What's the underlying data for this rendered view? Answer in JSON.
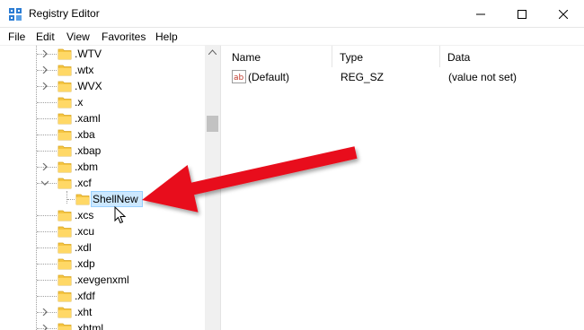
{
  "window": {
    "title": "Registry Editor",
    "icon": "registry-icon"
  },
  "menu": [
    "File",
    "Edit",
    "View",
    "Favorites",
    "Help"
  ],
  "tree": {
    "items": [
      {
        "label": ".WTV",
        "expandable": true
      },
      {
        "label": ".wtx",
        "expandable": true
      },
      {
        "label": ".WVX",
        "expandable": true
      },
      {
        "label": ".x",
        "expandable": false
      },
      {
        "label": ".xaml",
        "expandable": false
      },
      {
        "label": ".xba",
        "expandable": false
      },
      {
        "label": ".xbap",
        "expandable": false
      },
      {
        "label": ".xbm",
        "expandable": true
      },
      {
        "label": ".xcf",
        "expandable": true,
        "expanded": true
      },
      {
        "label": "ShellNew",
        "expandable": false,
        "child": true,
        "selected": true
      },
      {
        "label": ".xcs",
        "expandable": false
      },
      {
        "label": ".xcu",
        "expandable": false
      },
      {
        "label": ".xdl",
        "expandable": false
      },
      {
        "label": ".xdp",
        "expandable": false
      },
      {
        "label": ".xevgenxml",
        "expandable": false
      },
      {
        "label": ".xfdf",
        "expandable": false
      },
      {
        "label": ".xht",
        "expandable": true
      },
      {
        "label": ".xhtml",
        "expandable": true
      }
    ]
  },
  "list": {
    "columns": [
      "Name",
      "Type",
      "Data"
    ],
    "rows": [
      {
        "name": "(Default)",
        "type": "REG_SZ",
        "data": "(value not set)",
        "icon": "string-value-icon"
      }
    ]
  },
  "annotation": {
    "arrow_color": "#e8111b",
    "points_to": "ShellNew"
  },
  "colors": {
    "folder": "#f5c542",
    "selection": "#cce8ff"
  }
}
